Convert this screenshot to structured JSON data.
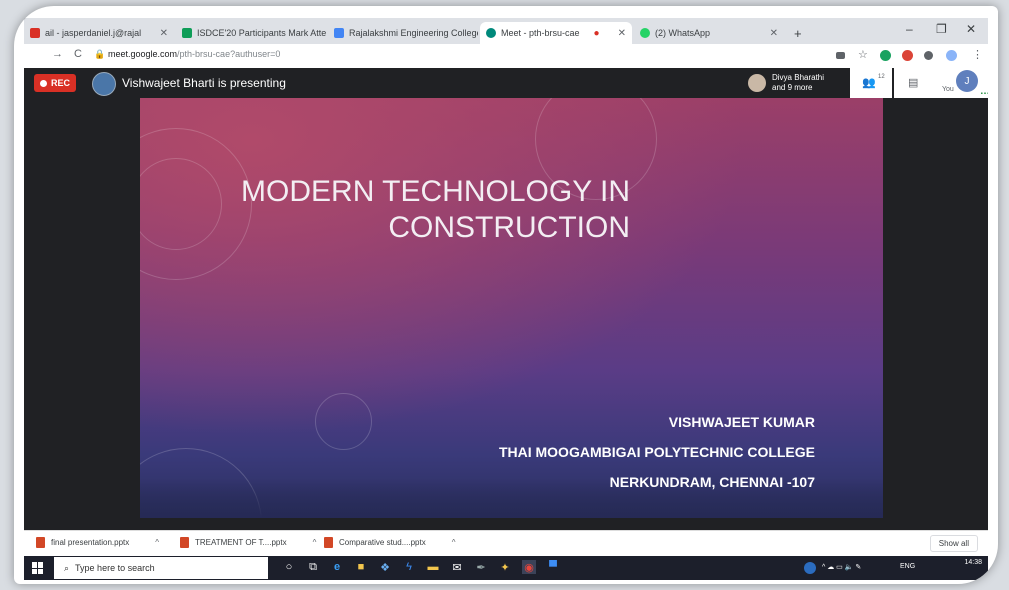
{
  "browser": {
    "tabs": [
      {
        "label": "ail - jasperdaniel.j@rajal",
        "favicon_color": "#d93025",
        "active": false
      },
      {
        "label": "ISDCE'20 Participants Mark Atte",
        "favicon_color": "#0f9d58",
        "active": false
      },
      {
        "label": "Rajalakshmi Engineering College",
        "favicon_color": "#4285f4",
        "active": false
      },
      {
        "label": "Meet - pth-brsu-cae",
        "favicon_color": "#00897b",
        "active": true
      },
      {
        "label": "(2) WhatsApp",
        "favicon_color": "#25d366",
        "active": false
      }
    ],
    "new_tab": "+",
    "window_controls": {
      "minimize": "–",
      "restore": "❐",
      "close": "✕"
    },
    "address": {
      "domain": "meet.google.com",
      "path": "/pth-brsu-cae?authuser=0"
    }
  },
  "meet": {
    "rec_label": "REC",
    "presenting_text": "Vishwajeet Bharti is presenting",
    "participants_line1": "Divya Bharathi",
    "participants_line2": "and 9 more",
    "people_count": "12",
    "you_label": "You",
    "you_initial": "J"
  },
  "slide": {
    "title_line1": "MODERN TECHNOLOGY IN",
    "title_line2": "CONSTRUCTION",
    "author": "VISHWAJEET KUMAR",
    "college": "THAI MOOGAMBIGAI POLYTECHNIC COLLEGE",
    "address": "NERKUNDRAM, CHENNAI -107"
  },
  "downloads": {
    "items": [
      {
        "name": "final presentation.pptx"
      },
      {
        "name": "TREATMENT OF T....pptx"
      },
      {
        "name": "Comparative stud....pptx"
      }
    ],
    "show_all": "Show all"
  },
  "taskbar": {
    "search_placeholder": "Type here to search",
    "language": "ENG",
    "time": "14:38"
  }
}
